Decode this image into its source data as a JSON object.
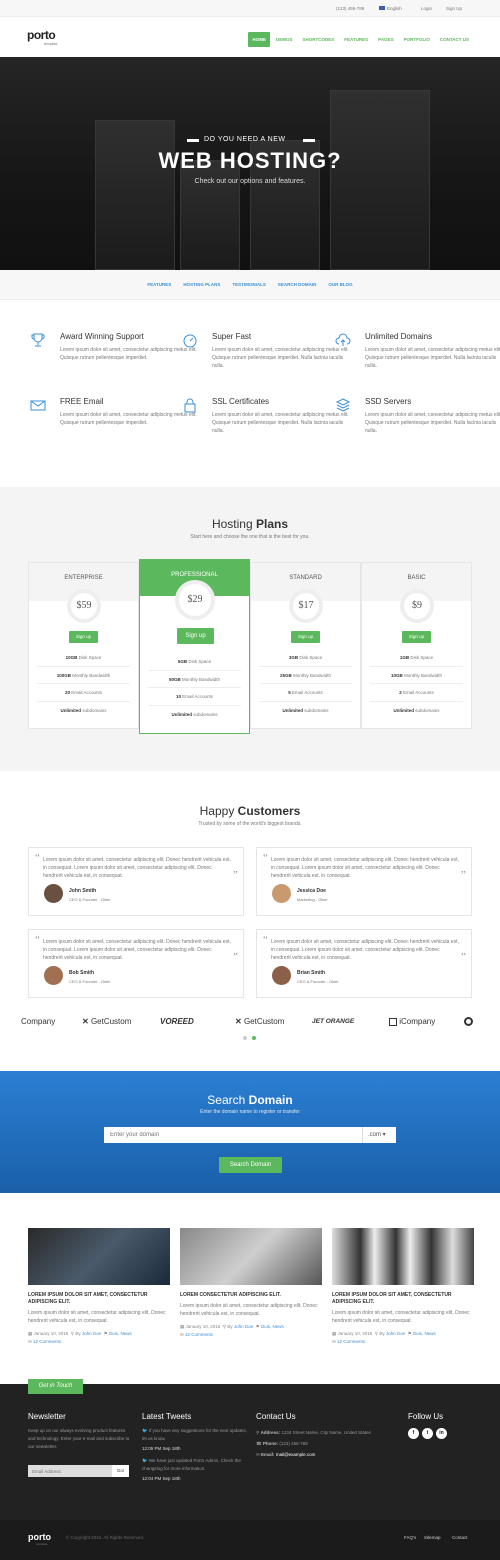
{
  "topbar": {
    "phone": "(123) 456-789",
    "language": "English",
    "login": "Login",
    "signup": "Sign Up"
  },
  "brand": {
    "name": "porto",
    "tagline": "template"
  },
  "nav": [
    "HOME",
    "DEMOS",
    "SHORTCODES",
    "FEATURES",
    "PAGES",
    "PORTFOLIO",
    "CONTACT US"
  ],
  "hero": {
    "pretitle": "DO YOU NEED A NEW",
    "title": "WEB HOSTING?",
    "subtitle": "Check out our options and features."
  },
  "subnav": [
    "FEATURES",
    "HOSTING PLANS",
    "TESTIMONIALS",
    "SEARCH DOMAIN",
    "OUR BLOG"
  ],
  "features": [
    {
      "title": "Award Winning Support",
      "text": "Lorem ipsum dolor sit amet, consectetur adipiscing metus elit. Quisque rutrum pellentesque imperdiet.",
      "icon": "trophy-icon"
    },
    {
      "title": "Super Fast",
      "text": "Lorem ipsum dolor sit amet, consectetur adipiscing metus elit. Quisque rutrum pellentesque imperdiet. Nulla lacinia iaculis nulla.",
      "icon": "speedometer-icon"
    },
    {
      "title": "Unlimited Domains",
      "text": "Lorem ipsum dolor sit amet, consectetur adipiscing metus elit. Quisque rutrum pellentesque imperdiet. Nulla lacinia iaculis nulla.",
      "icon": "cloud-upload-icon"
    },
    {
      "title": "FREE Email",
      "text": "Lorem ipsum dolor sit amet, consectetur adipiscing metus elit. Quisque rutrum pellentesque imperdiet.",
      "icon": "envelope-icon"
    },
    {
      "title": "SSL Certificates",
      "text": "Lorem ipsum dolor sit amet, consectetur adipiscing metus elit. Quisque rutrum pellentesque imperdiet. Nulla lacinia iaculis nulla.",
      "icon": "lock-icon"
    },
    {
      "title": "SSD Servers",
      "text": "Lorem ipsum dolor sit amet, consectetur adipiscing metus elit. Quisque rutrum pellentesque imperdiet. Nulla lacinia iaculis nulla.",
      "icon": "layers-icon"
    }
  ],
  "plans": {
    "title_light": "Hosting",
    "title_bold": "Plans",
    "subtitle": "Start here and choose the one that is the best for you.",
    "items": [
      {
        "name": "ENTERPRISE",
        "price": "$59",
        "button": "Sign up",
        "rows": [
          [
            "10GB",
            " Disk Space"
          ],
          [
            "100GB",
            " Monthly Bandwidth"
          ],
          [
            "20",
            " Email Accounts"
          ],
          [
            "Unlimited",
            " subdomains"
          ]
        ]
      },
      {
        "name": "PROFESSIONAL",
        "price": "$29",
        "button": "Sign up",
        "rows": [
          [
            "5GB",
            " Disk Space"
          ],
          [
            "50GB",
            " Monthly Bandwidth"
          ],
          [
            "10",
            " Email Accounts"
          ],
          [
            "Unlimited",
            " subdomains"
          ]
        ]
      },
      {
        "name": "STANDARD",
        "price": "$17",
        "button": "Sign up",
        "rows": [
          [
            "3GB",
            " Disk Space"
          ],
          [
            "25GB",
            " Monthly Bandwidth"
          ],
          [
            "5",
            " Email Accounts"
          ],
          [
            "Unlimited",
            " subdomains"
          ]
        ]
      },
      {
        "name": "BASIC",
        "price": "$9",
        "button": "Sign up",
        "rows": [
          [
            "1GB",
            " Disk Space"
          ],
          [
            "10GB",
            " Monthly Bandwidth"
          ],
          [
            "2",
            " Email Accounts"
          ],
          [
            "Unlimited",
            " subdomains"
          ]
        ]
      }
    ]
  },
  "testimonials": {
    "title_light": "Happy",
    "title_bold": "Customers",
    "subtitle": "Trusted by some of the world's biggest brands.",
    "items": [
      {
        "text": "Lorem ipsum dolor sit amet, consectetur adipiscing elit. Donec hendrerit vehicula est, in consequat. Lorem ipsum dolor sit amet, consectetur adipiscing elit. Donec hendrerit vehicula est, in consequat.",
        "name": "John Smith",
        "role": "CEO & Founder - Okler"
      },
      {
        "text": "Lorem ipsum dolor sit amet, consectetur adipiscing elit. Donec hendrerit vehicula est, in consequat. Lorem ipsum dolor sit amet, consectetur adipiscing elit. Donec hendrerit vehicula est, in consequat.",
        "name": "Jessica Doe",
        "role": "Marketing - Okler"
      },
      {
        "text": "Lorem ipsum dolor sit amet, consectetur adipiscing elit. Donec hendrerit vehicula est, in consequat. Lorem ipsum dolor sit amet, consectetur adipiscing elit. Donec hendrerit vehicula est, in consequat.",
        "name": "Bob Smith",
        "role": "CEO & Founder - Okler"
      },
      {
        "text": "Lorem ipsum dolor sit amet, consectetur adipiscing elit. Donec hendrerit vehicula est, in consequat. Lorem ipsum dolor sit amet, consectetur adipiscing elit. Donec hendrerit vehicula est, in consequat.",
        "name": "Brian Smith",
        "role": "CEO & Founder - Okler"
      }
    ]
  },
  "logos": [
    "Company",
    "GetCustom",
    "VOREED",
    "GetCustom",
    "JET ORANGE",
    "iCompany"
  ],
  "search": {
    "title_light": "Search",
    "title_bold": "Domain",
    "subtitle": "Enter the domain name to register or transfer",
    "placeholder": "Enter your domain",
    "tld": ".com",
    "button": "Search Domain"
  },
  "blog": [
    {
      "title": "LOREM IPSUM DOLOR SIT AMET, CONSECTETUR ADIPISCING ELIT.",
      "text": "Lorem ipsum dolor sit amet, consectetur adipiscing elit. Donec hendrerit vehicula est, in consequat.",
      "date": "January 10, 2016",
      "by": "By",
      "author": "John Doe",
      "tags": "Duis, News",
      "comments": "12 Comments"
    },
    {
      "title": "LOREM CONSECTETUR ADIPISCING ELIT.",
      "text": "Lorem ipsum dolor sit amet, consectetur adipiscing elit. Donec hendrerit vehicula est, in consequat.",
      "date": "January 10, 2016",
      "by": "By",
      "author": "John Doe",
      "tags": "Duis, News",
      "comments": "12 Comments"
    },
    {
      "title": "LOREM IPSUM DOLOR SIT AMET, CONSECTETUR ADIPISCING ELIT.",
      "text": "Lorem ipsum dolor sit amet, consectetur adipiscing elit. Donec hendrerit vehicula est, in consequat.",
      "date": "January 10, 2016",
      "by": "By",
      "author": "John Doe",
      "tags": "Duis, News",
      "comments": "12 Comments"
    }
  ],
  "footer": {
    "tab": "Get in Touch",
    "newsletter_title": "Newsletter",
    "newsletter_text": "Keep up on our always evolving product features and technology. Enter your e-mail and subscribe to our newsletter.",
    "email_placeholder": "Email Address",
    "go": "Go!",
    "tweets_title": "Latest Tweets",
    "tweets": [
      {
        "text": "If you have any suggestions for the next updates, let us know.",
        "time": "12:05 PM Sep 18th"
      },
      {
        "text": "We have just updated Porto Admin. Check the changelog for more information.",
        "time": "12:04 PM Sep 18th"
      }
    ],
    "contact_title": "Contact Us",
    "address_label": "Address:",
    "address": "1234 Street Name, City Name, United States",
    "phone_label": "Phone:",
    "phone": "(123) 456-789",
    "email_label": "Email:",
    "email": "mail@example.com",
    "follow_title": "Follow Us",
    "copyright": "© Copyright 2016. All Rights Reserved.",
    "links": [
      "FAQ's",
      "Sitemap",
      "Contact"
    ]
  },
  "colors": {
    "accent": "#5cb85c",
    "link": "#3a8fd8",
    "footer": "#222222",
    "blue": "#2b7fd4"
  }
}
